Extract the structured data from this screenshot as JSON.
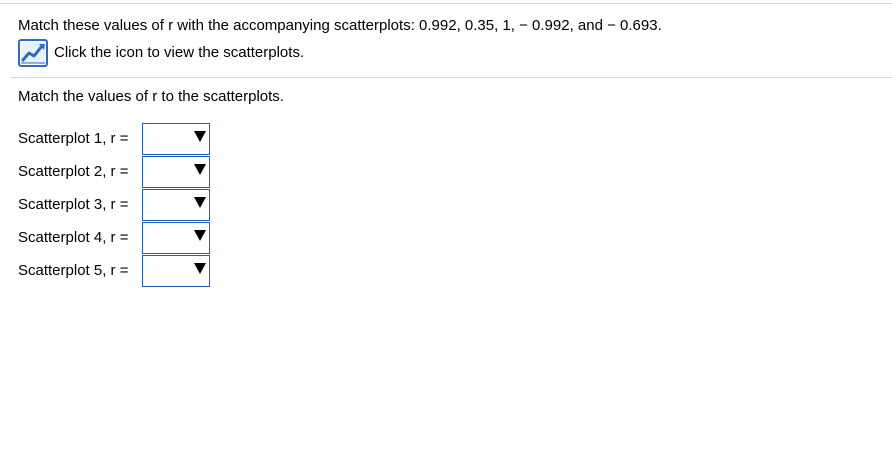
{
  "question": {
    "text": "Match these values of r with the accompanying scatterplots: 0.992, 0.35, 1,  − 0.992, and  − 0.693."
  },
  "scatterplot_link": {
    "label": "Click the icon to view the scatterplots.",
    "icon": "line-chart-icon"
  },
  "instruction": "Match the values of r to the scatterplots.",
  "rows": [
    {
      "label": "Scatterplot 1, r =",
      "selected": ""
    },
    {
      "label": "Scatterplot 2, r =",
      "selected": ""
    },
    {
      "label": "Scatterplot 3, r =",
      "selected": ""
    },
    {
      "label": "Scatterplot 4, r =",
      "selected": ""
    },
    {
      "label": "Scatterplot 5, r =",
      "selected": ""
    }
  ],
  "colors": {
    "select_border": "#1f5fbf",
    "icon_blue": "#2a6cc9",
    "rule": "#d9d9d9"
  }
}
